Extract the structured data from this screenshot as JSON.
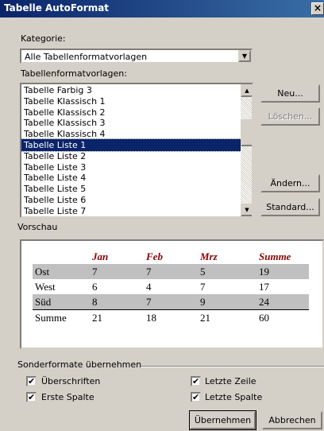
{
  "window": {
    "title": "Tabelle AutoFormat",
    "close_glyph": "×"
  },
  "category": {
    "label": "Kategorie:",
    "value": "Alle Tabellenformatvorlagen"
  },
  "styles_list": {
    "label": "Tabellenformatvorlagen:",
    "items": [
      "Tabelle Farbig 3",
      "Tabelle Klassisch 1",
      "Tabelle Klassisch 2",
      "Tabelle Klassisch 3",
      "Tabelle Klassisch 4",
      "Tabelle Liste 1",
      "Tabelle Liste 2",
      "Tabelle Liste 3",
      "Tabelle Liste 4",
      "Tabelle Liste 5",
      "Tabelle Liste 6",
      "Tabelle Liste 7"
    ],
    "selected_index": 5
  },
  "side_buttons": {
    "new": "Neu...",
    "delete": "Löschen...",
    "change": "Ändern...",
    "standard": "Standard..."
  },
  "preview": {
    "label": "Vorschau",
    "table": {
      "header": [
        "",
        "Jan",
        "Feb",
        "Mrz",
        "Summe"
      ],
      "rows": [
        [
          "Ost",
          "7",
          "7",
          "5",
          "19"
        ],
        [
          "West",
          "6",
          "4",
          "7",
          "17"
        ],
        [
          "Süd",
          "8",
          "7",
          "9",
          "24"
        ],
        [
          "Summe",
          "21",
          "18",
          "21",
          "60"
        ]
      ]
    }
  },
  "special_formats": {
    "label": "Sonderformate übernehmen",
    "headings": {
      "label": "Überschriften",
      "checked": true
    },
    "first_column": {
      "label": "Erste Spalte",
      "checked": true
    },
    "last_row": {
      "label": "Letzte Zeile",
      "checked": true
    },
    "last_column": {
      "label": "Letzte Spalte",
      "checked": true
    }
  },
  "footer": {
    "apply": "Übernehmen",
    "cancel": "Abbrechen"
  },
  "icons": {
    "check": "✔",
    "arrow_down": "▼",
    "arrow_up": "▲"
  }
}
